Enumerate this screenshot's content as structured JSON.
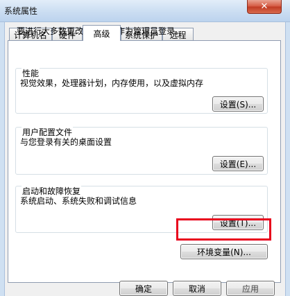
{
  "window": {
    "title": "系统属性",
    "close_glyph": "✕"
  },
  "tabs": [
    {
      "label": "计算机名",
      "active": false
    },
    {
      "label": "硬件",
      "active": false
    },
    {
      "label": "高级",
      "active": true
    },
    {
      "label": "系统保护",
      "active": false
    },
    {
      "label": "远程",
      "active": false
    }
  ],
  "intro": "要进行大多数更改，您必须作为管理员登录。",
  "performance": {
    "title": "性能",
    "desc": "视觉效果，处理器计划，内存使用，以及虚拟内存",
    "button": "设置(S)..."
  },
  "profiles": {
    "title": "用户配置文件",
    "desc": "与您登录有关的桌面设置",
    "button": "设置(E)..."
  },
  "startup": {
    "title": "启动和故障恢复",
    "desc": "系统启动、系统失败和调试信息",
    "button": "设置(T)..."
  },
  "env_button": "环境变量(N)...",
  "footer": {
    "ok": "确定",
    "cancel": "取消",
    "apply": "应用"
  },
  "colors": {
    "highlight": "#e8001c",
    "close": "#c03a22"
  }
}
